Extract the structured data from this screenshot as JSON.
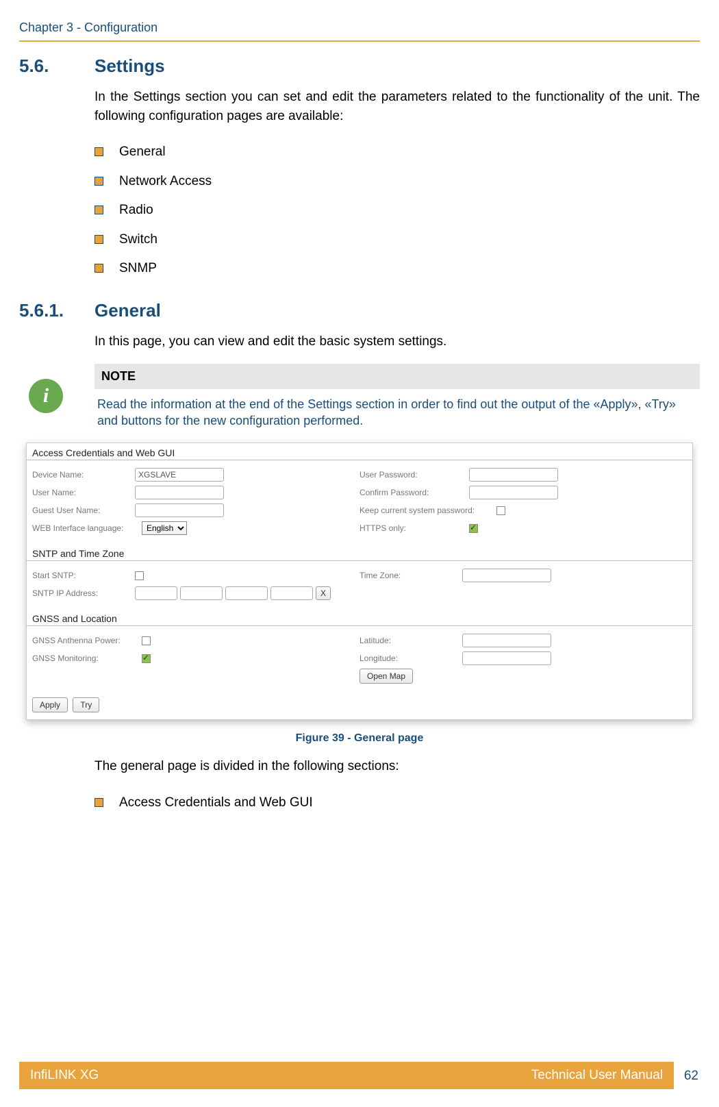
{
  "header": {
    "chapter": "Chapter 3 - Configuration"
  },
  "section1": {
    "num": "5.6.",
    "title": "Settings",
    "intro": "In the Settings section you can set and edit the parameters related to the functionality of the unit. The following configuration pages are available:",
    "items": [
      "General",
      "Network Access",
      "Radio",
      "Switch",
      "SNMP"
    ]
  },
  "section2": {
    "num": "5.6.1.",
    "title": "General",
    "intro": "In this page, you can view and edit the basic system settings."
  },
  "note": {
    "label": "NOTE",
    "text": "Read the information at the end of the Settings section in order to find out the output of the «Apply», «Try» and buttons for the new configuration performed."
  },
  "shot": {
    "sec_access": "Access Credentials and Web GUI",
    "device_name_lbl": "Device Name:",
    "device_name_val": "XGSLAVE",
    "user_name_lbl": "User Name:",
    "guest_user_lbl": "Guest User Name:",
    "lang_lbl": "WEB Interface language:",
    "lang_val": "English",
    "user_pw_lbl": "User Password:",
    "confirm_pw_lbl": "Confirm Password:",
    "keep_pw_lbl": "Keep current system password:",
    "https_lbl": "HTTPS only:",
    "sec_sntp": "SNTP and Time Zone",
    "start_sntp_lbl": "Start SNTP:",
    "sntp_ip_lbl": "SNTP IP Address:",
    "tz_lbl": "Time Zone:",
    "x_btn": "X",
    "sec_gnss": "GNSS and Location",
    "gnss_ant_lbl": "GNSS Anthenna Power:",
    "gnss_mon_lbl": "GNSS Monitoring:",
    "lat_lbl": "Latitude:",
    "lon_lbl": "Longitude:",
    "open_map_btn": "Open Map",
    "apply_btn": "Apply",
    "try_btn": "Try"
  },
  "figure": "Figure 39 - General page",
  "after_figure": "The general page is divided in the following sections:",
  "after_items": [
    "Access Credentials and Web GUI"
  ],
  "footer": {
    "left": "InfiLINK XG",
    "right": "Technical User Manual",
    "page": "62"
  }
}
